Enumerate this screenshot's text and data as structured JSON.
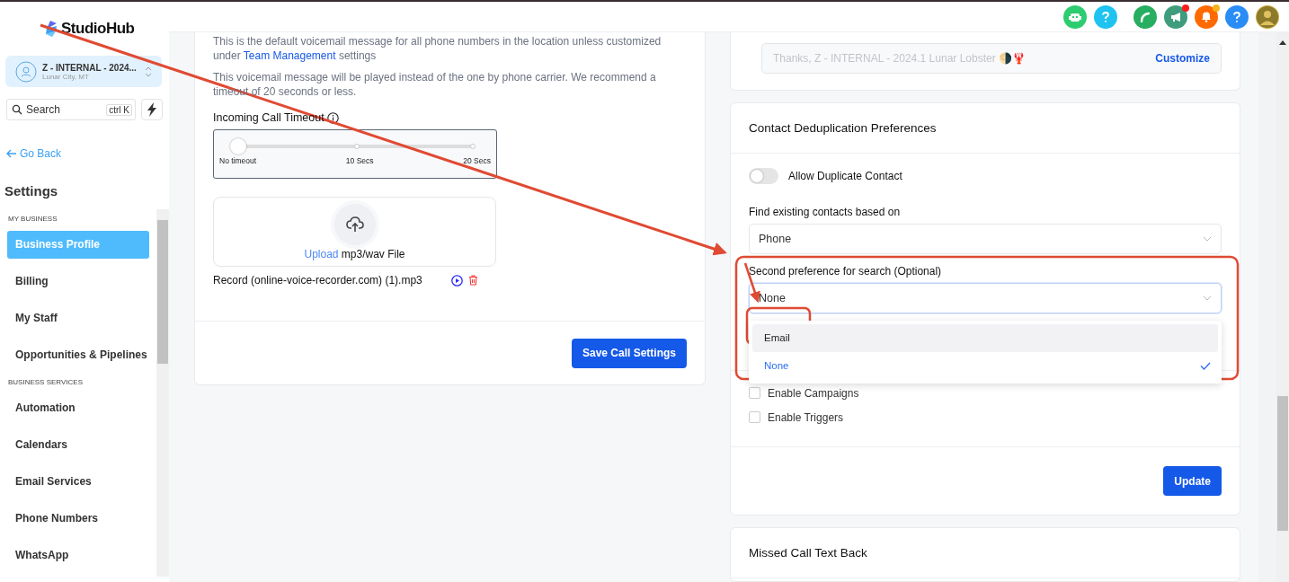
{
  "brand": {
    "name": "StudioHub"
  },
  "location": {
    "name": "Z - INTERNAL - 2024...",
    "city": "Lunar City, MT"
  },
  "search": {
    "placeholder": "Search",
    "shortcut": "ctrl K"
  },
  "back_link": "Go Back",
  "sidebar": {
    "title": "Settings",
    "sections": [
      {
        "heading": "MY BUSINESS",
        "items": [
          {
            "label": "Business Profile",
            "selected": true
          },
          {
            "label": "Billing",
            "selected": false
          },
          {
            "label": "My Staff",
            "selected": false
          },
          {
            "label": "Opportunities & Pipelines",
            "selected": false
          }
        ]
      },
      {
        "heading": "BUSINESS SERVICES",
        "items": [
          {
            "label": "Automation",
            "selected": false
          },
          {
            "label": "Calendars",
            "selected": false
          },
          {
            "label": "Email Services",
            "selected": false
          },
          {
            "label": "Phone Numbers",
            "selected": false
          },
          {
            "label": "WhatsApp",
            "selected": false
          }
        ]
      }
    ]
  },
  "header_icons": [
    {
      "kind": "bot",
      "color": "#2ecc71"
    },
    {
      "kind": "help",
      "color": "#1ec3f0"
    },
    {
      "kind": "phone",
      "color": "#27ae60"
    },
    {
      "kind": "megaphone",
      "color": "#3f9c7c",
      "badge": {
        "color": "#ff1a1a"
      }
    },
    {
      "kind": "bell",
      "color": "#ff6a00",
      "badge": {
        "color": "#f5b31b"
      }
    },
    {
      "kind": "help",
      "color": "#2a8cf5"
    },
    {
      "kind": "avatar",
      "color": "#c9a436"
    }
  ],
  "call_settings": {
    "description_before": "This is the default voicemail message for all phone numbers in the location unless customized under",
    "description_link": "Team Management",
    "description_after": "settings",
    "note": "This voicemail message will be played instead of the one by phone carrier. We recommend a timeout of 20 seconds or less.",
    "timeout_label": "Incoming Call Timeout",
    "timeout": {
      "level": 0,
      "ticks": [
        "No timeout",
        "10 Secs",
        "20 Secs"
      ]
    },
    "upload_link": "Upload",
    "upload_text": "mp3/wav File",
    "file_name": "Record (online-voice-recorder.com) (1).mp3",
    "save_button": "Save Call Settings"
  },
  "message_field": {
    "value": "Thanks, Z - INTERNAL - 2024.1 Lunar Lobster 🌗🦞",
    "action": "Customize"
  },
  "deduplication": {
    "title": "Contact Deduplication Preferences",
    "allow_duplicate": {
      "label": "Allow Duplicate Contact",
      "on": false
    },
    "find_label": "Find existing contacts based on",
    "find_value": "Phone",
    "second_label": "Second preference for search (Optional)",
    "second_value": "None",
    "options": [
      {
        "label": "Email",
        "selected": false,
        "hovered": true
      },
      {
        "label": "None",
        "selected": true,
        "hovered": false
      }
    ],
    "checkboxes": [
      {
        "label": "Enable Campaigns",
        "checked": false
      },
      {
        "label": "Enable Triggers",
        "checked": false
      }
    ],
    "update_button": "Update"
  },
  "missed_call": {
    "title": "Missed Call Text Back"
  }
}
